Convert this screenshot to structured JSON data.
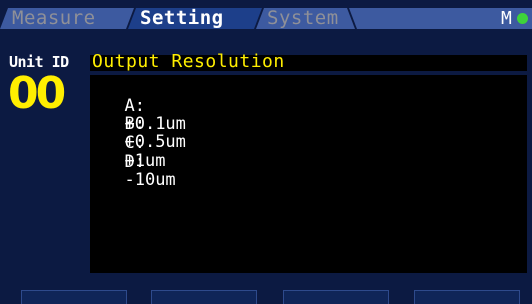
{
  "tabs": [
    {
      "label": "Measure",
      "active": false
    },
    {
      "label": "Setting",
      "active": true
    },
    {
      "label": "System",
      "active": false
    }
  ],
  "status": {
    "mode_letter": "M",
    "indicator_color": "#3ed33a"
  },
  "unit": {
    "label": "Unit ID",
    "value": "00"
  },
  "panel": {
    "title": "Output Resolution",
    "options": [
      {
        "key": "A:",
        "value": "+0.1um"
      },
      {
        "key": "B:",
        "value": "+0.5um"
      },
      {
        "key": "C:",
        "value": "+1um"
      },
      {
        "key": "D:",
        "value": "-10um"
      }
    ]
  },
  "colors": {
    "background": "#0c1a42",
    "accent_yellow": "#ffee00",
    "tab_active": "#1d3f8a",
    "tab_inactive": "#3d5aa0"
  }
}
